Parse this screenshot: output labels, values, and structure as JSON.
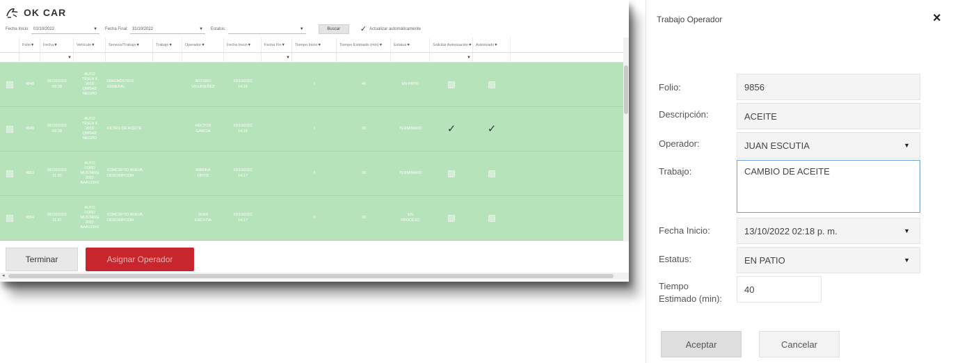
{
  "app": {
    "title": "OK CAR",
    "logo_icon": "car-logo-icon"
  },
  "filters": {
    "fecha_inicio_label": "Fecha Inicio:",
    "fecha_inicio_value": "01/10/2022",
    "fecha_final_label": "Fecha Final:",
    "fecha_final_value": "31/10/2022",
    "estatus_label": "Estatus:",
    "estatus_value": "",
    "buscar_label": "Buscar",
    "auto_update_label": "Actualizar automáticamente",
    "auto_update_checked": true
  },
  "grid": {
    "columns": [
      "",
      "Folio",
      "Fecha",
      "Vehículo",
      "Servicio/Trabajo",
      "Trabajo",
      "Operador",
      "Fecha Inicio",
      "Fecha Fin",
      "Tiempo Inicio",
      "Tiempo Estimado (min)",
      "Estatus",
      "Solicitar Autorización",
      "Autorizado"
    ],
    "rows": [
      {
        "folio": "9848",
        "fecha": "06/10/2022\n09:28",
        "vehiculo": "AUTO\nTESLA X\n2019\nQWSAD\nNEGRO",
        "servicio": "DIAGNÓSTICO\nGENERAL",
        "trabajo": "",
        "operador": "ARTURO\nVILLASEÑEZ",
        "fecha_inicio": "13/10/2022\n14:16",
        "fecha_fin": "",
        "tiempo_inicio": "1",
        "tiempo_estimado": "40",
        "estatus": "EN PATIO",
        "solicitar": false,
        "autorizado": false
      },
      {
        "folio": "9849",
        "fecha": "06/10/2022\n09:28",
        "vehiculo": "AUTO\nTESLA X\n2019\nQWSAD\nNEGRO",
        "servicio": "FILTRO DE ACEITE",
        "trabajo": "",
        "operador": "HECTOR\nGARCIA",
        "fecha_inicio": "13/10/2022\n14:16",
        "fecha_fin": "",
        "tiempo_inicio": "1",
        "tiempo_estimado": "30",
        "estatus": "TERMINADO",
        "solicitar": true,
        "autorizado": true
      },
      {
        "folio": "9853",
        "fecha": "06/10/2022\n11:35",
        "vehiculo": "AUTO\nFORD\nMUSTANG\n2022\nAAA1234S",
        "servicio": "CONCEPTO NUEVA\nDESCRIPCIÓN",
        "trabajo": "",
        "operador": "MARINA\nORTIZ",
        "fecha_inicio": "13/10/2022\n14:17",
        "fecha_fin": "",
        "tiempo_inicio": "5",
        "tiempo_estimado": "30",
        "estatus": "TERMINADO",
        "solicitar": false,
        "autorizado": false
      },
      {
        "folio": "9854",
        "fecha": "06/10/2022\n11:37",
        "vehiculo": "AUTO\nFORD\nMUSTANG\n2022\nAAA1234S",
        "servicio": "CONCEPTO NUEVA\nDESCRIPCIÓN",
        "trabajo": "",
        "operador": "JUAN\nESCUTIA",
        "fecha_inicio": "13/10/2022\n14:17",
        "fecha_fin": "",
        "tiempo_inicio": "0",
        "tiempo_estimado": "30",
        "estatus": "EN\nPROCESO",
        "solicitar": false,
        "autorizado": false
      }
    ],
    "row_color": "#b7e3bb"
  },
  "actions": {
    "terminar_label": "Terminar",
    "asignar_label": "Asignar Operador",
    "asignar_color": "#c7262e"
  },
  "dialog": {
    "title": "Trabajo Operador",
    "close_glyph": "×",
    "folio_label": "Folio:",
    "folio_value": "9856",
    "descripcion_label": "Descripción:",
    "descripcion_value": "ACEITE",
    "operador_label": "Operador:",
    "operador_value": "JUAN ESCUTIA",
    "trabajo_label": "Trabajo:",
    "trabajo_value": "CAMBIO DE ACEITE",
    "fecha_inicio_label": "Fecha Inicio:",
    "fecha_inicio_value": "13/10/2022 02:18 p. m.",
    "estatus_label": "Estatus:",
    "estatus_value": "EN PATIO",
    "tiempo_label": "Tiempo\nEstimado (min):",
    "tiempo_value": "40",
    "aceptar_label": "Aceptar",
    "cancelar_label": "Cancelar"
  }
}
